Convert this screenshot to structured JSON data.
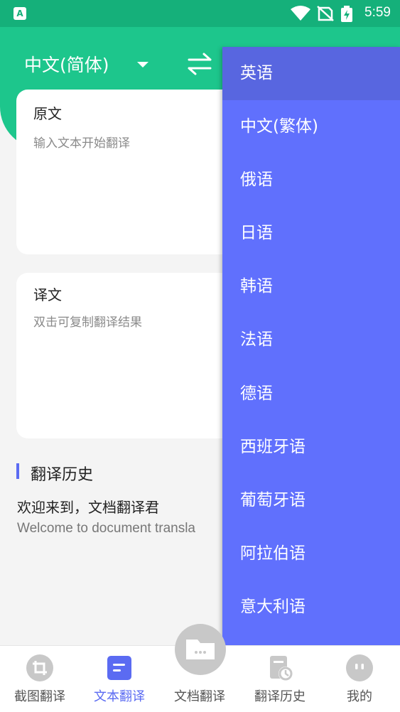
{
  "status_bar": {
    "app_badge": "A",
    "time": "5:59"
  },
  "header": {
    "source_language": "中文(简体)"
  },
  "source_card": {
    "title": "原文",
    "placeholder": "输入文本开始翻译"
  },
  "result_card": {
    "title": "译文",
    "placeholder": "双击可复制翻译结果"
  },
  "history": {
    "title": "翻译历史",
    "item_zh": "欢迎来到，文档翻译君",
    "item_en": "Welcome to document transla"
  },
  "language_menu": {
    "items": [
      {
        "label": "英语"
      },
      {
        "label": "中文(繁体)"
      },
      {
        "label": "俄语"
      },
      {
        "label": "日语"
      },
      {
        "label": "韩语"
      },
      {
        "label": "法语"
      },
      {
        "label": "德语"
      },
      {
        "label": "西班牙语"
      },
      {
        "label": "葡萄牙语"
      },
      {
        "label": "阿拉伯语"
      },
      {
        "label": "意大利语"
      }
    ],
    "selected": "英语"
  },
  "bottom_nav": {
    "items": [
      {
        "label": "截图翻译",
        "icon": "crop-icon"
      },
      {
        "label": "文本翻译",
        "icon": "text-doc-icon"
      },
      {
        "label": "文档翻译",
        "icon": "folder-icon"
      },
      {
        "label": "翻译历史",
        "icon": "history-icon"
      },
      {
        "label": "我的",
        "icon": "profile-icon"
      }
    ],
    "active": "文本翻译"
  },
  "colors": {
    "header_green": "#1dc68c",
    "status_green": "#15b07a",
    "menu_blue": "#6070fd",
    "accent_blue": "#5b6bf2"
  }
}
